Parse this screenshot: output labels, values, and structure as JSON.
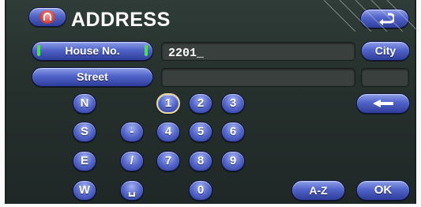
{
  "title": "ADDRESS",
  "buttons": {
    "house_no": "House No.",
    "city": "City",
    "street": "Street",
    "az": "A-Z",
    "ok": "OK"
  },
  "fields": {
    "house_no_value": "2201_",
    "street_value": "",
    "city_value": ""
  },
  "keys": {
    "directions": [
      "N",
      "S",
      "E",
      "W"
    ],
    "symbols": [
      "-",
      "/",
      "␣"
    ],
    "digits": [
      "1",
      "2",
      "3",
      "4",
      "5",
      "6",
      "7",
      "8",
      "9",
      "0"
    ]
  },
  "icons": {
    "menu": "menu-icon",
    "back": "back-arrow-icon",
    "delete": "backspace-icon"
  },
  "colors": {
    "button_blue": "#5063c9",
    "field_grey": "#3a403d",
    "indicator_green": "#49e24a",
    "menu_red": "#c03a3a"
  }
}
